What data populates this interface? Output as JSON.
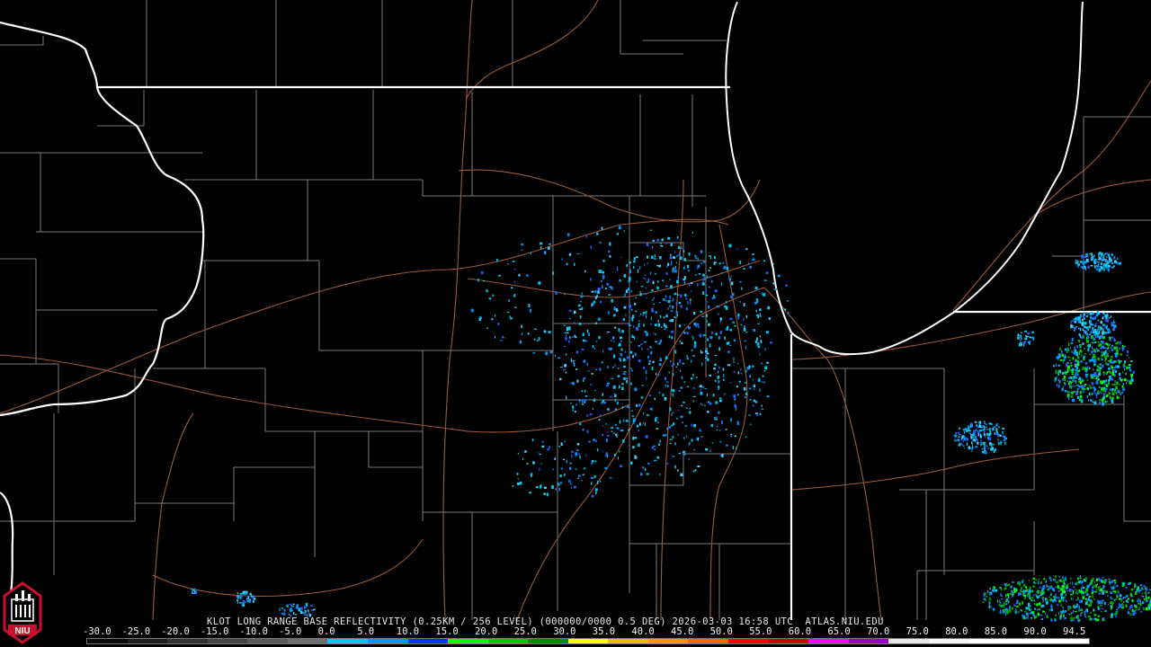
{
  "product": {
    "caption": "KLOT LONG RANGE BASE REFLECTIVITY (0.25KM / 256 LEVEL) (000000/0000 0.5 DEG) 2026-03-03 16:58 UTC  ATLAS.NIU.EDU"
  },
  "logo": {
    "text": "NIU",
    "icon": "niu-castle-logo-icon"
  },
  "scale": {
    "labels": [
      "-30.0",
      "-25.0",
      "-20.0",
      "-15.0",
      "-10.0",
      "-5.0",
      "0.0",
      "5.0",
      "10.0",
      "15.0",
      "20.0",
      "25.0",
      "30.0",
      "35.0",
      "40.0",
      "45.0",
      "50.0",
      "55.0",
      "60.0",
      "65.0",
      "70.0",
      "75.0",
      "80.0",
      "85.0",
      "90.0",
      "94.5"
    ],
    "colors": [
      "#0a0a0a",
      "#1e1e1e",
      "#323232",
      "#464646",
      "#5a5a5a",
      "#6e6e6e",
      "#00c8f0",
      "#0096ff",
      "#0032ff",
      "#00ff00",
      "#00c800",
      "#008c00",
      "#ffff00",
      "#e6c000",
      "#ff9600",
      "#ff6400",
      "#ff0000",
      "#c80000",
      "#ff00ff",
      "#9600c8",
      "#e6e6e6",
      "#f5f5f5",
      "#ffffff",
      "#ffffff",
      "#ffffff"
    ]
  },
  "colors": {
    "background": "#000000",
    "state_border": "#ffffff",
    "county_line": "#7a7a7a",
    "highway": "#9a5a3a"
  }
}
